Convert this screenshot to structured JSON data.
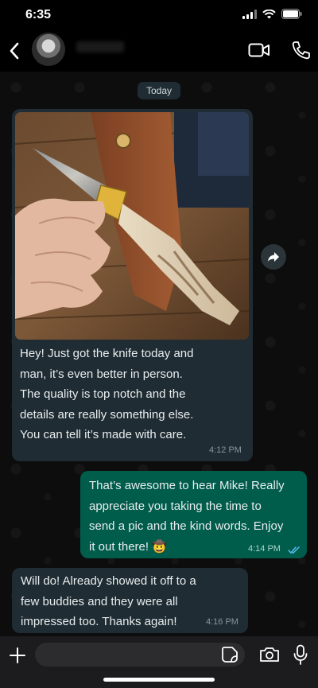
{
  "status_bar": {
    "time": "6:35"
  },
  "header": {
    "contact_name": "",
    "avatar_alt": "contact-avatar"
  },
  "chat": {
    "date_label": "Today",
    "messages": [
      {
        "direction": "incoming",
        "has_photo": true,
        "text": "Hey! Just got the knife today and man, it’s even better in person. The quality is top notch and the details are really something else. You can tell it’s made with care.",
        "lines": [
          "Hey! Just got the knife today and",
          "man, it’s even better in person.",
          "The quality is top notch and the",
          "details are really something else.",
          "You can tell it’s made with care."
        ],
        "time": "4:12 PM"
      },
      {
        "direction": "outgoing",
        "lines": [
          "That’s awesome to hear Mike! Really",
          "appreciate you taking the time to",
          "send a pic and the kind words. Enjoy",
          "it out there! 🤠"
        ],
        "time": "4:14 PM",
        "read_status": "read"
      },
      {
        "direction": "incoming",
        "lines": [
          "Will do! Already showed it off to a",
          "few buddies and they were all",
          "impressed too. Thanks again!"
        ],
        "time": "4:16 PM"
      }
    ]
  },
  "input": {
    "placeholder": "",
    "value": ""
  },
  "icons": {
    "back": "chevron-left-icon",
    "video": "video-camera-icon",
    "call": "phone-icon",
    "forward": "forward-arrow-icon",
    "plus": "plus-icon",
    "sticker": "sticker-icon",
    "camera": "camera-icon",
    "mic": "microphone-icon"
  },
  "colors": {
    "incoming_bubble": "#1f2c33",
    "outgoing_bubble": "#005c4b",
    "background": "#0b0b0b",
    "read_ticks": "#53bdeb"
  }
}
